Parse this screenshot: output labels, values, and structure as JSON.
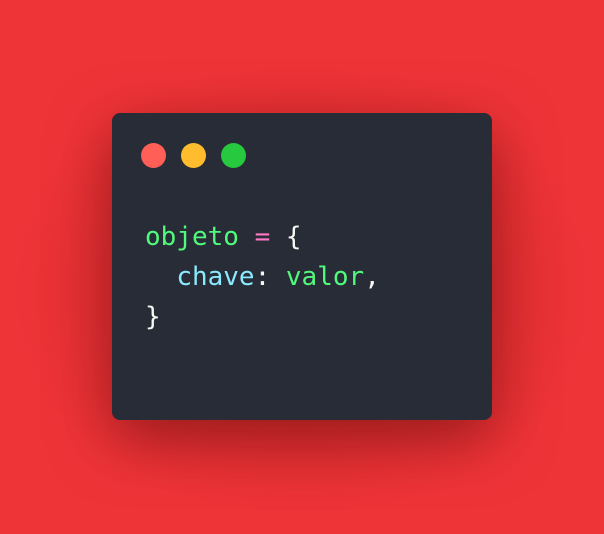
{
  "window": {
    "controls": [
      {
        "name": "close",
        "color": "#ff5f56"
      },
      {
        "name": "minimize",
        "color": "#ffbd2e"
      },
      {
        "name": "maximize",
        "color": "#27c93f"
      }
    ]
  },
  "code": {
    "line1": {
      "variable": "objeto",
      "space1": " ",
      "operator": "=",
      "space2": " ",
      "open_brace": "{"
    },
    "line2": {
      "indent": "  ",
      "key": "chave",
      "colon": ": ",
      "value": "valor",
      "comma": ","
    },
    "line3": {
      "close_brace": "}"
    }
  },
  "colors": {
    "background": "#ef3438",
    "window": "#282c37",
    "variable": "#50fa7b",
    "operator": "#ff79c6",
    "key": "#8be9fd",
    "text": "#f8f8f2"
  }
}
